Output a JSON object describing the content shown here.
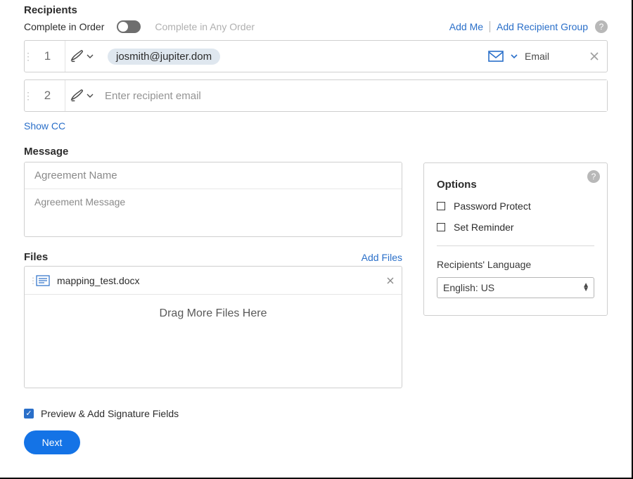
{
  "section_recipients": "Recipients",
  "complete_in_order": "Complete in Order",
  "complete_in_any_order": "Complete in Any Order",
  "actions": {
    "add_me": "Add Me",
    "add_group": "Add Recipient Group"
  },
  "recipients": [
    {
      "index": "1",
      "email": "josmith@jupiter.dom",
      "delivery_label": "Email"
    },
    {
      "index": "2",
      "placeholder": "Enter recipient email"
    }
  ],
  "show_cc": "Show CC",
  "section_message": "Message",
  "message": {
    "name_placeholder": "Agreement Name",
    "body_placeholder": "Agreement Message"
  },
  "section_files": "Files",
  "add_files": "Add Files",
  "files": [
    {
      "name": "mapping_test.docx"
    }
  ],
  "drop_hint": "Drag More Files Here",
  "options": {
    "title": "Options",
    "password": "Password Protect",
    "reminder": "Set Reminder",
    "lang_label": "Recipients' Language",
    "lang_value": "English: US"
  },
  "preview_label": "Preview & Add Signature Fields",
  "next_label": "Next"
}
